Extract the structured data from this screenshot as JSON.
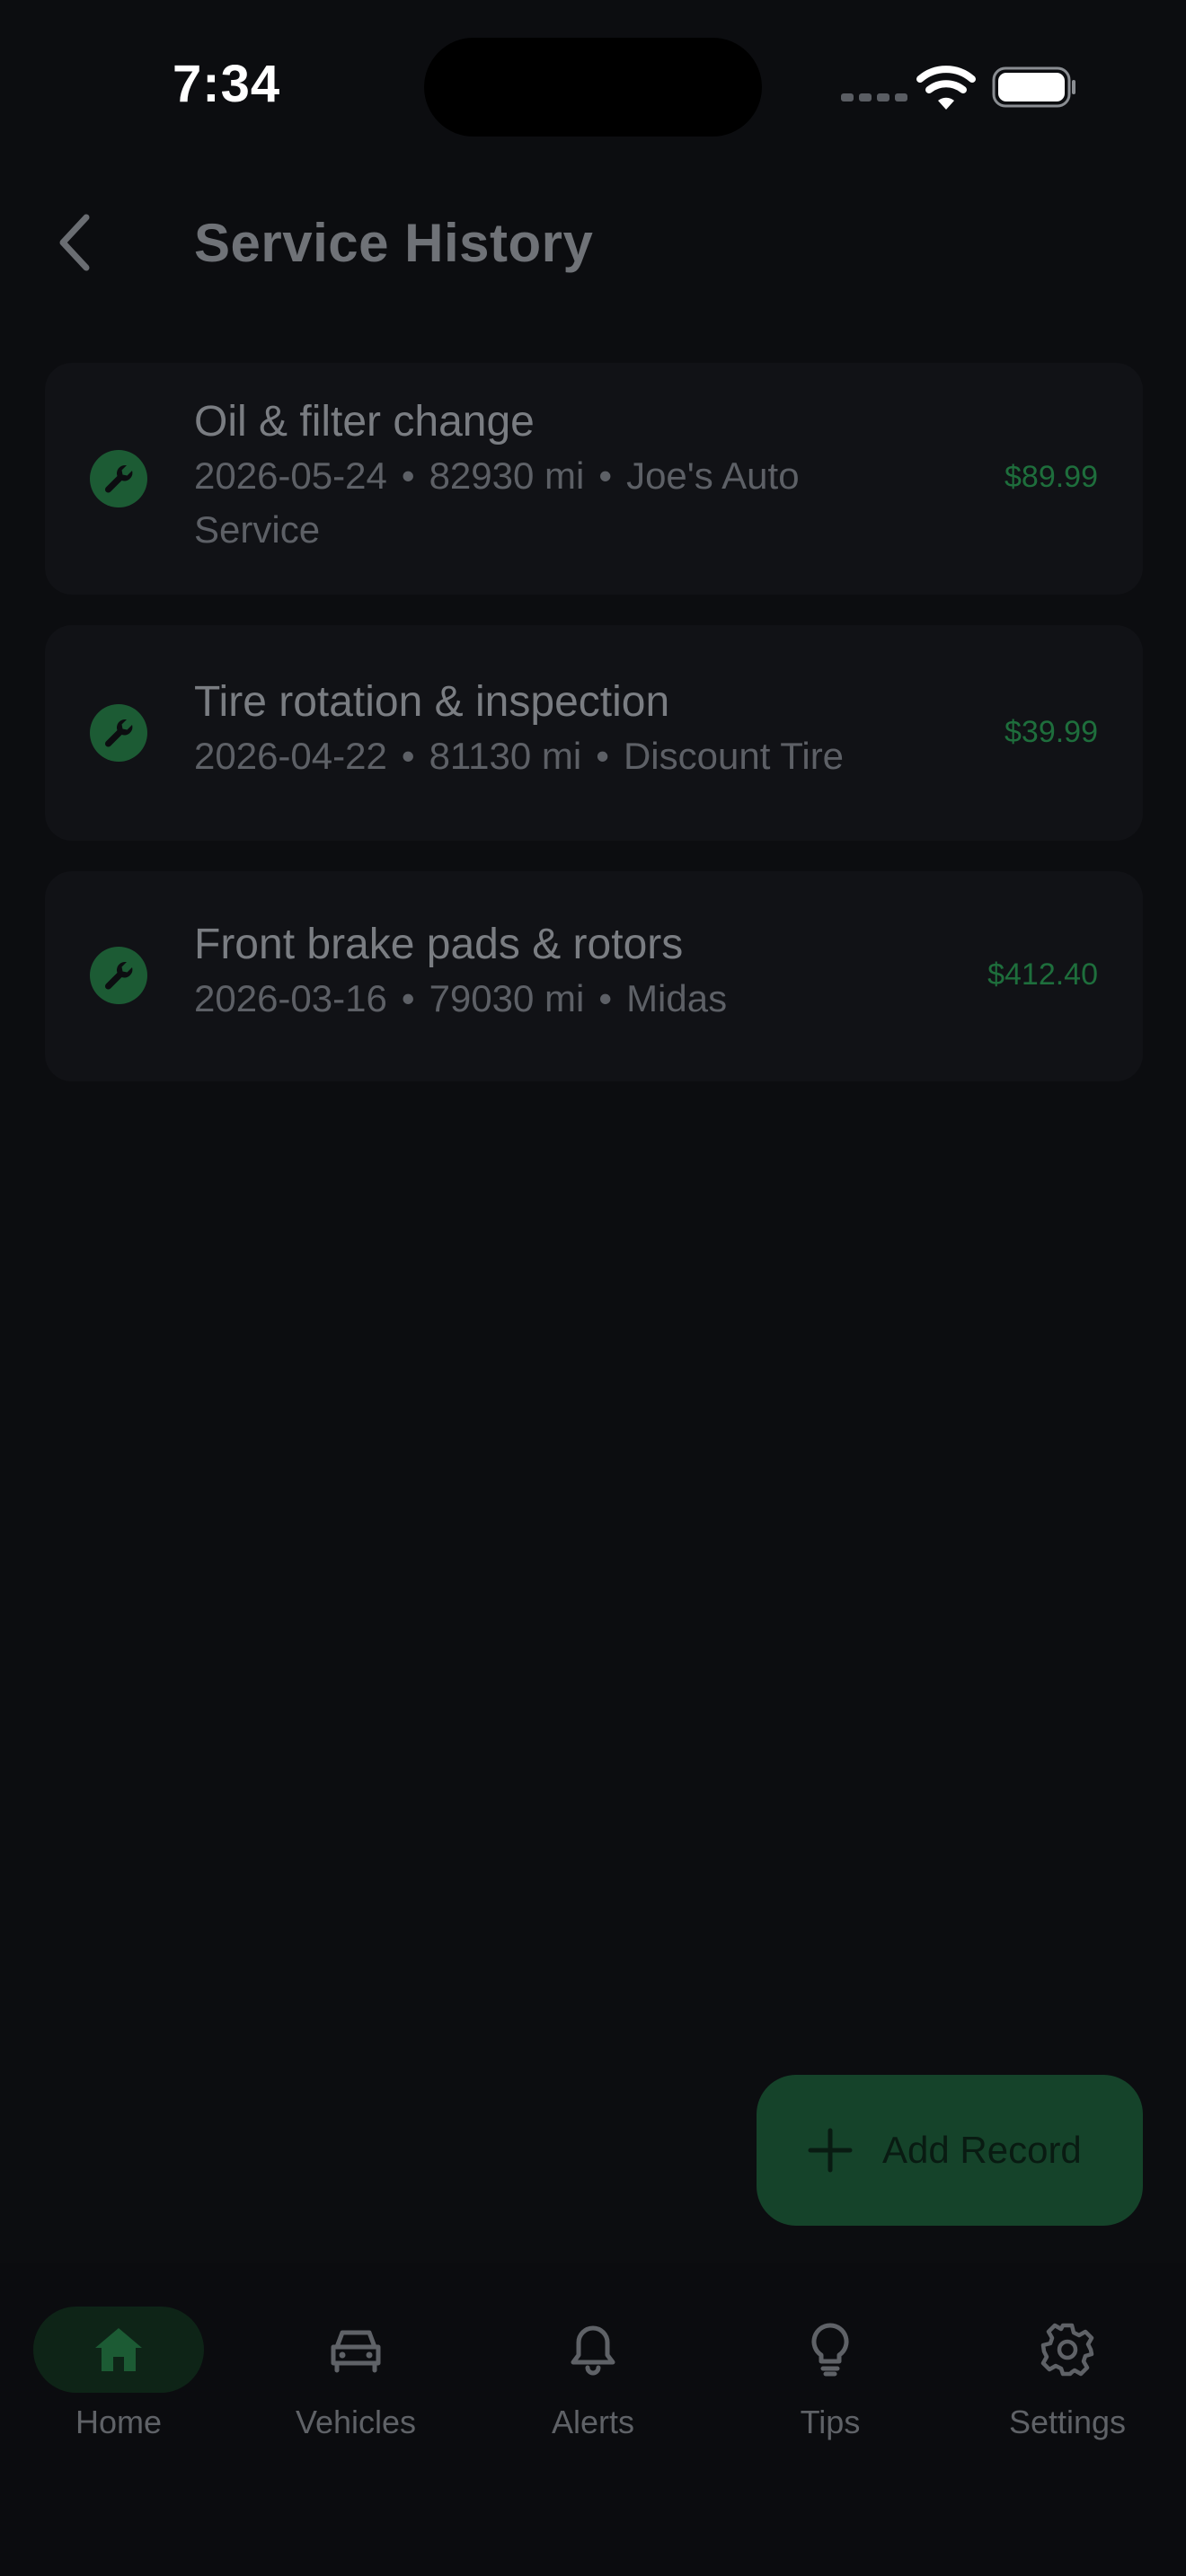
{
  "status_bar": {
    "time": "7:34"
  },
  "header": {
    "title": "Service History"
  },
  "records": [
    {
      "title": "Oil & filter change",
      "date": "2026-05-24",
      "mileage": "82930 mi",
      "shop_line1": "Joe's Auto",
      "shop_line2": "Service",
      "cost": "$89.99"
    },
    {
      "title": "Tire rotation & inspection",
      "date": "2026-04-22",
      "mileage": "81130 mi",
      "shop_line1": "Discount Tire",
      "cost": "$39.99"
    },
    {
      "title": "Front brake pads & rotors",
      "date": "2026-03-16",
      "mileage": "79030 mi",
      "shop_line1": "Midas",
      "cost": "$412.40"
    }
  ],
  "separator": "•",
  "fab": {
    "label": "Add Record",
    "icon": "plus-icon"
  },
  "nav": {
    "active": "Home",
    "items": [
      {
        "label": "Home",
        "icon": "home-icon"
      },
      {
        "label": "Vehicles",
        "icon": "car-icon"
      },
      {
        "label": "Alerts",
        "icon": "bell-icon"
      },
      {
        "label": "Tips",
        "icon": "lightbulb-icon"
      },
      {
        "label": "Settings",
        "icon": "gear-icon"
      }
    ]
  },
  "colors": {
    "accent": "#1e6e3c",
    "background": "#0c0d10",
    "card": "#111216"
  }
}
